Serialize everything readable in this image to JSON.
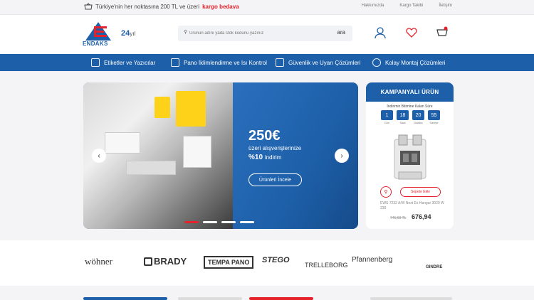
{
  "topbar": {
    "message_prefix": "Türkiye'nin her noktasına 200 TL ve üzeri",
    "message_highlight": "kargo bedava",
    "links": [
      "Hakkımızda",
      "Kargo Takibi",
      "İletişim"
    ]
  },
  "header": {
    "logo_text": "ENDAKS",
    "years_num": "24",
    "years_suffix": "yıl",
    "search_placeholder": "Ürünün adını yada stok kodunu yazınız",
    "search_button": "ara"
  },
  "nav": {
    "items": [
      {
        "label": "Etiketler ve Yazıcılar",
        "icon": "printer-icon"
      },
      {
        "label": "Pano İklimlendirme ve Isı Kontrol",
        "icon": "climate-icon"
      },
      {
        "label": "Güvenlik ve Uyarı Çözümleri",
        "icon": "shield-icon"
      },
      {
        "label": "Kolay Montaj Çözümleri",
        "icon": "gear-icon"
      }
    ]
  },
  "hero": {
    "price": "250€",
    "line1": "üzeri alışverişlerinize",
    "discount": "%10",
    "discount_word": "indirim",
    "button": "Ürünleri İncele",
    "active_slide": 1,
    "slide_count": 4
  },
  "campaign": {
    "title": "KAMPANYALI ÜRÜN",
    "countdown_label": "İndirimin Bitimine Kalan Süre",
    "timer": [
      {
        "value": "1",
        "label": "Gün"
      },
      {
        "value": "18",
        "label": "Saat"
      },
      {
        "value": "20",
        "label": "Dakika"
      },
      {
        "value": "55",
        "label": "Saniye"
      }
    ],
    "cart_button": "Sepete Ekle",
    "product_name": "EWS 7232 A/W Next Ex Hangar 3020 W 230",
    "old_price": "746,69 TL",
    "new_price": "676,94"
  },
  "brands": [
    "wöhner",
    "BRADY",
    "TEMPA PANO",
    "STEGO",
    "TRELLEBORG",
    "Pfannenberg",
    "GINDRE"
  ],
  "colors": {
    "brand_blue": "#1d5fa8",
    "accent_red": "#e5222c"
  }
}
